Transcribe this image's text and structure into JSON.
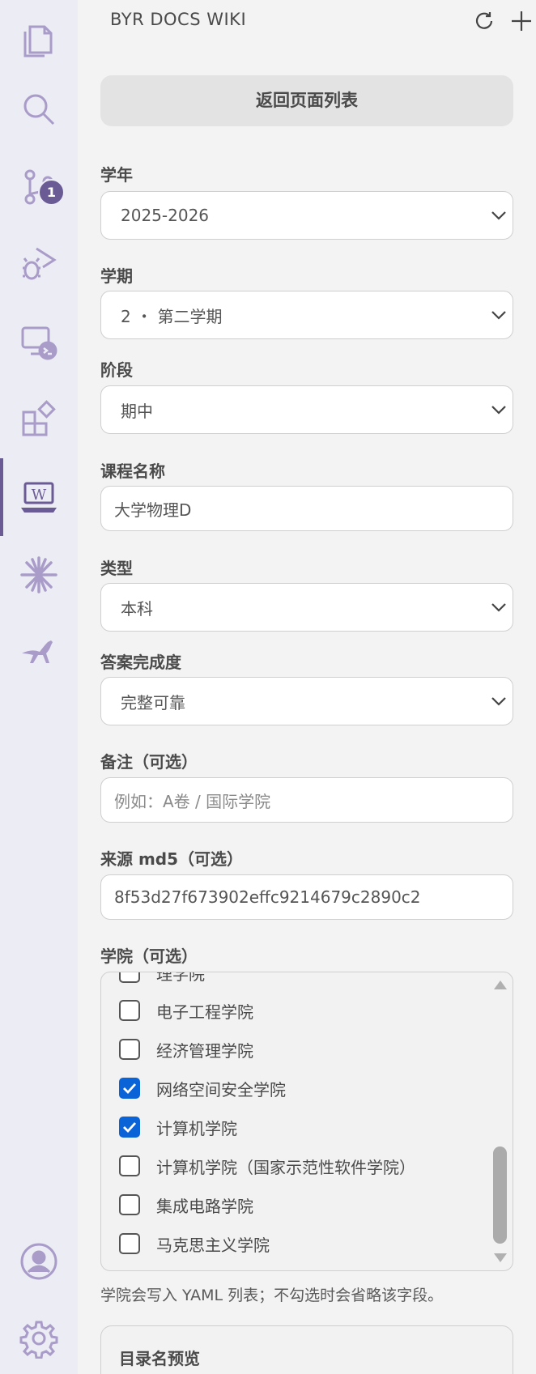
{
  "activity_bar": {
    "items": [
      {
        "icon": "explorer-icon"
      },
      {
        "icon": "search-icon"
      },
      {
        "icon": "source-control-icon",
        "badge": "1"
      },
      {
        "icon": "run-debug-icon"
      },
      {
        "icon": "remote-explorer-icon"
      },
      {
        "icon": "extensions-icon"
      },
      {
        "icon": "wiki-laptop-icon",
        "active": true
      },
      {
        "icon": "sparkle-icon"
      },
      {
        "icon": "kangaroo-icon"
      }
    ],
    "bottom": [
      {
        "icon": "account-icon"
      },
      {
        "icon": "settings-gear-icon"
      }
    ],
    "accent": "#6b5b95",
    "icon_color": "#a99cc9"
  },
  "panel": {
    "title": "BYR DOCS WIKI",
    "back_button": "返回页面列表"
  },
  "form": {
    "year": {
      "label": "学年",
      "value": "2025-2026"
    },
    "semester": {
      "label": "学期",
      "value": "2 ・ 第二学期"
    },
    "stage": {
      "label": "阶段",
      "value": "期中"
    },
    "course": {
      "label": "课程名称",
      "value": "大学物理D"
    },
    "type": {
      "label": "类型",
      "value": "本科"
    },
    "completeness": {
      "label": "答案完成度",
      "value": "完整可靠"
    },
    "remark": {
      "label": "备注（可选）",
      "placeholder": "例如：A卷 / 国际学院"
    },
    "md5": {
      "label": "来源 md5（可选）",
      "value": "8f53d27f673902effc9214679c2890c2"
    },
    "college": {
      "label": "学院（可选）",
      "items": [
        {
          "label": "理学院",
          "checked": false
        },
        {
          "label": "电子工程学院",
          "checked": false
        },
        {
          "label": "经济管理学院",
          "checked": false
        },
        {
          "label": "网络空间安全学院",
          "checked": true
        },
        {
          "label": "计算机学院",
          "checked": true
        },
        {
          "label": "计算机学院（国家示范性软件学院）",
          "checked": false
        },
        {
          "label": "集成电路学院",
          "checked": false
        },
        {
          "label": "马克思主义学院",
          "checked": false
        }
      ],
      "hint": "学院会写入 YAML 列表；不勾选时会省略该字段。"
    },
    "preview": {
      "title": "目录名预览"
    }
  }
}
